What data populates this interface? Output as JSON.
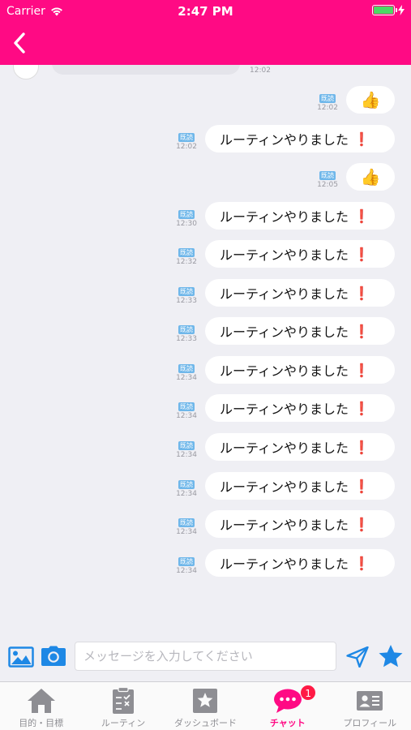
{
  "status_bar": {
    "carrier": "Carrier",
    "time": "2:47 PM"
  },
  "colors": {
    "header": "#ff0a84",
    "accent": "#ff0a84",
    "read_badge": "#6fb7ea",
    "send_icon": "#1e88e5",
    "badge": "#ff1a45"
  },
  "chat": {
    "incoming_time": "12:02",
    "messages": [
      {
        "text": "👍",
        "read": "既読",
        "time": "12:02",
        "emoji": true
      },
      {
        "text": "ルーティンやりました",
        "mark": "❗",
        "read": "既読",
        "time": "12:02",
        "emoji": false
      },
      {
        "text": "👍",
        "read": "既読",
        "time": "12:05",
        "emoji": true
      },
      {
        "text": "ルーティンやりました",
        "mark": "❗",
        "read": "既読",
        "time": "12:30",
        "emoji": false
      },
      {
        "text": "ルーティンやりました",
        "mark": "❗",
        "read": "既読",
        "time": "12:32",
        "emoji": false
      },
      {
        "text": "ルーティンやりました",
        "mark": "❗",
        "read": "既読",
        "time": "12:33",
        "emoji": false
      },
      {
        "text": "ルーティンやりました",
        "mark": "❗",
        "read": "既読",
        "time": "12:33",
        "emoji": false
      },
      {
        "text": "ルーティンやりました",
        "mark": "❗",
        "read": "既読",
        "time": "12:34",
        "emoji": false
      },
      {
        "text": "ルーティンやりました",
        "mark": "❗",
        "read": "既読",
        "time": "12:34",
        "emoji": false
      },
      {
        "text": "ルーティンやりました",
        "mark": "❗",
        "read": "既読",
        "time": "12:34",
        "emoji": false
      },
      {
        "text": "ルーティンやりました",
        "mark": "❗",
        "read": "既読",
        "time": "12:34",
        "emoji": false
      },
      {
        "text": "ルーティンやりました",
        "mark": "❗",
        "read": "既読",
        "time": "12:34",
        "emoji": false
      },
      {
        "text": "ルーティンやりました",
        "mark": "❗",
        "read": "既読",
        "time": "12:34",
        "emoji": false
      }
    ]
  },
  "input": {
    "placeholder": "メッセージを入力してください"
  },
  "icons": {
    "back": "chevron-left-icon",
    "image": "image-icon",
    "camera": "camera-icon",
    "send": "send-icon",
    "favorite": "star-icon"
  },
  "tabs": [
    {
      "label": "目的・目標",
      "icon": "home-icon",
      "active": false
    },
    {
      "label": "ルーティン",
      "icon": "checklist-icon",
      "active": false
    },
    {
      "label": "ダッシュボード",
      "icon": "star-box-icon",
      "active": false
    },
    {
      "label": "チャット",
      "icon": "chat-bubble-icon",
      "active": true,
      "badge": "1"
    },
    {
      "label": "プロフィール",
      "icon": "id-card-icon",
      "active": false
    }
  ]
}
